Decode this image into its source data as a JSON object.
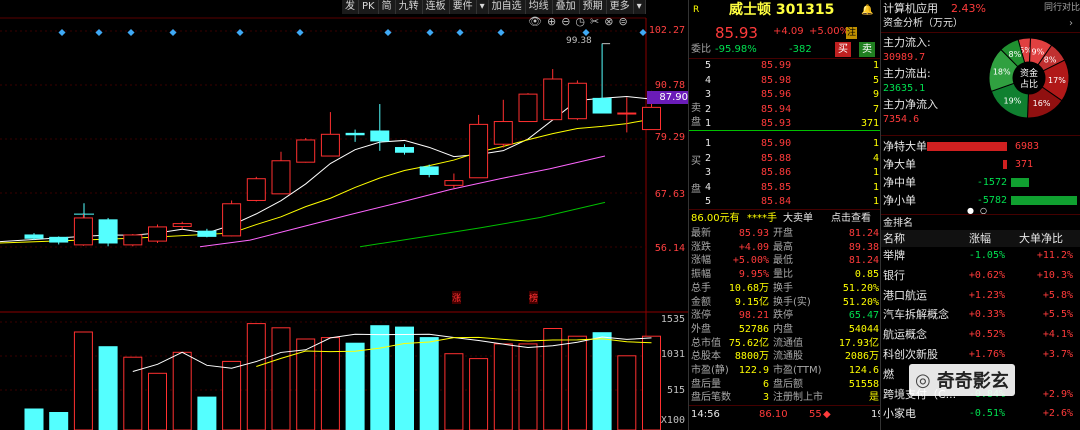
{
  "toolbar": [
    "发",
    "PK",
    "简",
    "九转",
    "连板",
    "要件",
    "▾",
    "加自选",
    "均线",
    "叠加",
    "预期",
    "更多",
    "▾"
  ],
  "chart": {
    "price_labels": [
      "102.27",
      "90.78",
      "79.29",
      "67.63",
      "56.14"
    ],
    "current_price_tag": "87.90",
    "high_label": "99.38",
    "vol_labels": [
      "1535",
      "1031",
      "515",
      "X100"
    ],
    "tags": [
      "涨",
      "榜"
    ],
    "colors": {
      "up": "#ff3030",
      "down": "#54ffff",
      "ma5": "#ffffff",
      "ma10": "#ffff00",
      "ma20": "#ff66ff",
      "ma60": "#00c000"
    }
  },
  "chart_data": {
    "type": "candlestick",
    "candles": [
      {
        "o": 58.9,
        "c": 58.2,
        "h": 59.3,
        "l": 57.8
      },
      {
        "o": 58.4,
        "c": 57.4,
        "h": 58.6,
        "l": 56.9
      },
      {
        "o": 56.8,
        "c": 62.5,
        "h": 63.3,
        "l": 56.6
      },
      {
        "o": 62.1,
        "c": 57.2,
        "h": 62.5,
        "l": 56.5
      },
      {
        "o": 56.8,
        "c": 58.9,
        "h": 59.1,
        "l": 56.5
      },
      {
        "o": 57.6,
        "c": 60.6,
        "h": 61.1,
        "l": 57.2
      },
      {
        "o": 60.7,
        "c": 61.3,
        "h": 61.7,
        "l": 60.1
      },
      {
        "o": 59.7,
        "c": 58.6,
        "h": 60.2,
        "l": 58.4
      },
      {
        "o": 58.7,
        "c": 65.5,
        "h": 66.2,
        "l": 58.6
      },
      {
        "o": 66.2,
        "c": 70.8,
        "h": 71.2,
        "l": 66.0
      },
      {
        "o": 67.6,
        "c": 74.6,
        "h": 76.5,
        "l": 67.6
      },
      {
        "o": 74.3,
        "c": 79.0,
        "h": 79.4,
        "l": 74.2
      },
      {
        "o": 75.6,
        "c": 80.2,
        "h": 84.9,
        "l": 75.6
      },
      {
        "o": 80.4,
        "c": 80.1,
        "h": 81.2,
        "l": 78.6
      },
      {
        "o": 80.9,
        "c": 78.8,
        "h": 86.6,
        "l": 76.7
      },
      {
        "o": 77.4,
        "c": 76.4,
        "h": 78.1,
        "l": 75.9
      },
      {
        "o": 73.3,
        "c": 71.7,
        "h": 73.8,
        "l": 71.1
      },
      {
        "o": 69.4,
        "c": 70.4,
        "h": 71.9,
        "l": 68.8
      },
      {
        "o": 71.0,
        "c": 82.3,
        "h": 84.3,
        "l": 71.0
      },
      {
        "o": 78.1,
        "c": 82.9,
        "h": 87.5,
        "l": 77.4
      },
      {
        "o": 82.9,
        "c": 88.7,
        "h": 88.9,
        "l": 82.9
      },
      {
        "o": 83.3,
        "c": 91.9,
        "h": 94.0,
        "l": 83.3
      },
      {
        "o": 83.5,
        "c": 91.0,
        "h": 91.6,
        "l": 83.2
      },
      {
        "o": 87.8,
        "c": 84.7,
        "h": 99.4,
        "l": 84.7
      },
      {
        "o": 84.7,
        "c": 84.7,
        "h": 88.0,
        "l": 80.6
      },
      {
        "o": 81.2,
        "c": 85.9,
        "h": 89.4,
        "l": 81.2
      }
    ],
    "volume": [
      300,
      250,
      1400,
      1190,
      1040,
      810,
      1110,
      470,
      980,
      1520,
      1460,
      1300,
      1320,
      1240,
      1490,
      1470,
      1320,
      1090,
      1020,
      1230,
      1230,
      1450,
      1340,
      1390,
      1060,
      1340
    ]
  },
  "mid": {
    "sector_icon": "R",
    "stock_name": "威士顿 301315",
    "price": "85.93",
    "change": "+4.09",
    "change_pct": "+5.00%",
    "badge": "注",
    "weibi_label": "委比",
    "weibi_val": "-95.98%",
    "weicha_val": "-382",
    "buy_btn": "买",
    "sell_btn": "卖",
    "sell_side_label": [
      "卖",
      "盘"
    ],
    "buy_side_label": [
      "买",
      "盘"
    ],
    "sells": [
      {
        "n": "5",
        "p": "85.99",
        "v": "1"
      },
      {
        "n": "4",
        "p": "85.98",
        "v": "5"
      },
      {
        "n": "3",
        "p": "85.96",
        "v": "9"
      },
      {
        "n": "2",
        "p": "85.94",
        "v": "7"
      },
      {
        "n": "1",
        "p": "85.93",
        "v": "371"
      }
    ],
    "buys": [
      {
        "n": "1",
        "p": "85.90",
        "v": "1"
      },
      {
        "n": "2",
        "p": "85.88",
        "v": "4"
      },
      {
        "n": "3",
        "p": "85.86",
        "v": "1"
      },
      {
        "n": "4",
        "p": "85.85",
        "v": "1"
      },
      {
        "n": "5",
        "p": "85.84",
        "v": "1"
      }
    ],
    "bigorder": {
      "price": "86.00元有",
      "qty": "****手",
      "label1": "大卖单",
      "label2": "点击查看"
    },
    "stats": [
      [
        "最新",
        "85.93",
        "开盘",
        "81.24"
      ],
      [
        "涨跌",
        "+4.09",
        "最高",
        "89.38"
      ],
      [
        "涨幅",
        "+5.00%",
        "最低",
        "81.24"
      ],
      [
        "振幅",
        "9.95%",
        "量比",
        "0.85"
      ],
      [
        "总手",
        "10.68万",
        "换手",
        "51.20%"
      ],
      [
        "金额",
        "9.15亿",
        "换手(实)",
        "51.20%"
      ],
      [
        "涨停",
        "98.21",
        "跌停",
        "65.47"
      ],
      [
        "外盘",
        "52786",
        "内盘",
        "54044"
      ],
      [
        "总市值",
        "75.62亿",
        "流通值",
        "17.93亿"
      ],
      [
        "总股本",
        "8800万",
        "流通股",
        "2086万"
      ],
      [
        "市盈(静)",
        "122.9",
        "市盈(TTM)",
        "124.6"
      ],
      [
        "盘后量",
        "6",
        "盘后额",
        "51558"
      ],
      [
        "盘后笔数",
        "3",
        "注册制上市",
        "是"
      ]
    ],
    "tick": {
      "time": "14:56",
      "price": "86.10",
      "vol": "55",
      "dir": "◆",
      "n": "19"
    }
  },
  "right": {
    "sector_name": "计算机应用",
    "sector_pct": "2.43%",
    "sector_link": "同行对比",
    "fund_title": "资金分析（万元）",
    "flows": [
      {
        "label": "主力流入:",
        "val": "30989.7"
      },
      {
        "label": "主力流出:",
        "val": "23635.1"
      },
      {
        "label": "主力净流入",
        "val": "7354.6"
      }
    ],
    "pie_center": [
      "资金",
      "占比"
    ],
    "pie_labels": [
      "5%",
      "9%",
      "8%",
      "17%",
      "16%",
      "19%",
      "18%",
      "8%"
    ],
    "net": [
      {
        "label": "净特大单",
        "val": "6983",
        "ratio": 1.0,
        "color": "#d02020"
      },
      {
        "label": "净大单",
        "val": "371",
        "ratio": 0.05,
        "color": "#d02020"
      },
      {
        "label": "净中单",
        "val": "-1572",
        "ratio": 0.23,
        "color": "#10a030"
      },
      {
        "label": "净小单",
        "val": "-5782",
        "ratio": 0.83,
        "color": "#10a030"
      }
    ],
    "rank_title": "金排名",
    "rank_headers": [
      "名称",
      "涨幅",
      "大单净比"
    ],
    "rank_rows": [
      [
        "举牌",
        "-1.05%",
        "+11.2%"
      ],
      [
        "银行",
        "+0.62%",
        "+10.3%"
      ],
      [
        "港口航运",
        "+1.23%",
        "+5.8%"
      ],
      [
        "汽车拆解概念",
        "+0.33%",
        "+5.5%"
      ],
      [
        "航运概念",
        "+0.52%",
        "+4.1%"
      ],
      [
        "科创次新股",
        "+1.76%",
        "+3.7%"
      ],
      [
        "燃",
        "",
        ""
      ],
      [
        "跨境支付（C...",
        "-0.84%",
        "+2.9%"
      ],
      [
        "小家电",
        "-0.51%",
        "+2.6%"
      ]
    ],
    "watermark": "奇奇影玄"
  }
}
